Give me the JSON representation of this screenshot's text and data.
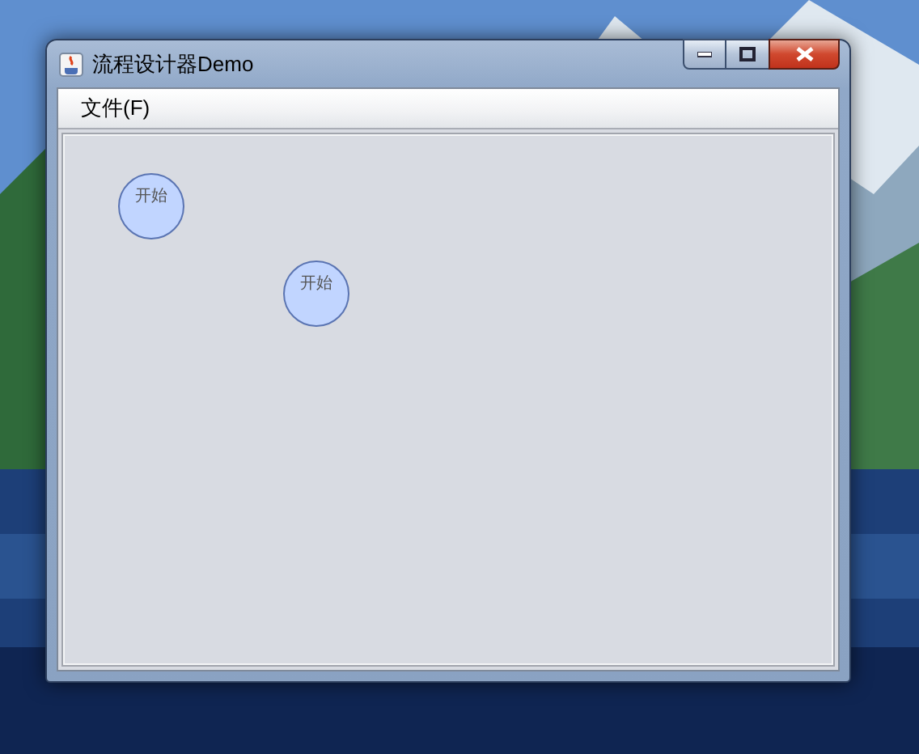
{
  "window": {
    "title": "流程设计器Demo"
  },
  "menu": [
    {
      "label": "文件(F)"
    }
  ],
  "canvas": {
    "nodes": [
      {
        "label": "开始"
      },
      {
        "label": "开始"
      }
    ]
  }
}
